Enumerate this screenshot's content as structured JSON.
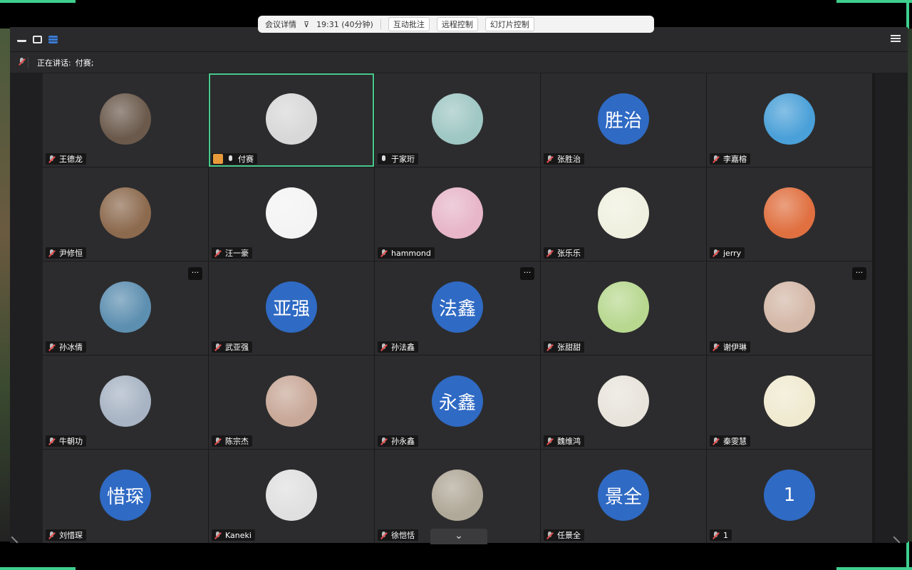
{
  "meeting_toolbar": {
    "details": "会议详情",
    "time": "19:31 (40分钟)",
    "annotation": "互动批注",
    "remote_control": "远程控制",
    "slides": "幻灯片控制"
  },
  "speaking": {
    "label": "正在讲话:",
    "name": "付赛;"
  },
  "colors": {
    "avatar_text_bg": "#2f6ac4",
    "active_border": "#49c98c",
    "tile_bg": "#2c2c2e"
  },
  "participants": [
    {
      "name": "王德龙",
      "avatar": "photo-person",
      "avatar_color": "#6b5a4c",
      "mic": "off"
    },
    {
      "name": "付赛",
      "avatar": "photo-cat",
      "avatar_color": "#d8d8d8",
      "mic": "on",
      "host": true,
      "active": true
    },
    {
      "name": "于家珩",
      "avatar": "photo-anime",
      "avatar_color": "#9fc7c4",
      "mic": "on"
    },
    {
      "name": "张胜治",
      "avatar_text": "胜治",
      "mic": "off"
    },
    {
      "name": "李嘉榕",
      "avatar": "photo-stairs",
      "avatar_color": "#4aa0d8",
      "mic": "off"
    },
    {
      "name": "尹修恒",
      "avatar": "photo-bear",
      "avatar_color": "#8c6a4e",
      "mic": "off"
    },
    {
      "name": "汪一豪",
      "avatar": "photo-sketch",
      "avatar_color": "#f4f4f4",
      "mic": "off"
    },
    {
      "name": "hammond",
      "avatar": "photo-anime-pink",
      "avatar_color": "#e7b6c8",
      "mic": "off"
    },
    {
      "name": "张乐乐",
      "avatar": "photo-cartoon",
      "avatar_color": "#f0f0e0",
      "mic": "off"
    },
    {
      "name": "jerry",
      "avatar": "photo-sunset",
      "avatar_color": "#e07040",
      "mic": "off"
    },
    {
      "name": "孙冰倩",
      "avatar": "photo-leaf",
      "avatar_color": "#5d8fb0",
      "mic": "off",
      "more": true
    },
    {
      "name": "武亚强",
      "avatar_text": "亚强",
      "mic": "off"
    },
    {
      "name": "孙法鑫",
      "avatar_text": "法鑫",
      "mic": "off",
      "more": true
    },
    {
      "name": "张甜甜",
      "avatar": "photo-cartoon-boy",
      "avatar_color": "#b8d890",
      "mic": "off"
    },
    {
      "name": "谢伊琳",
      "avatar": "photo-girl",
      "avatar_color": "#d4b8a8",
      "mic": "off",
      "more": true
    },
    {
      "name": "牛朝功",
      "avatar": "photo-cap",
      "avatar_color": "#a8b4c4",
      "mic": "off"
    },
    {
      "name": "陈宗杰",
      "avatar": "photo-face",
      "avatar_color": "#c8a898",
      "mic": "off"
    },
    {
      "name": "孙永鑫",
      "avatar_text": "永鑫",
      "mic": "off"
    },
    {
      "name": "魏维鸿",
      "avatar": "photo-poster",
      "avatar_color": "#e8e4dc",
      "mic": "off"
    },
    {
      "name": "秦雯慧",
      "avatar": "photo-crayon",
      "avatar_color": "#f0ead0",
      "mic": "off"
    },
    {
      "name": "刘惜琛",
      "avatar_text": "惜琛",
      "mic": "off"
    },
    {
      "name": "Kaneki",
      "avatar": "photo-manga",
      "avatar_color": "#e0e0e0",
      "mic": "off"
    },
    {
      "name": "徐恺恬",
      "avatar": "photo-cat-grey",
      "avatar_color": "#b0a898",
      "mic": "off"
    },
    {
      "name": "任景全",
      "avatar_text": "景全",
      "mic": "off"
    },
    {
      "name": "1",
      "avatar_text": "1",
      "mic": "off"
    }
  ],
  "icons": {
    "minimize": "minimize-icon",
    "window": "window-icon",
    "layout": "list-layout-icon",
    "menu": "menu-icon",
    "expand": "chevron-down-icon",
    "more": "more-icon"
  },
  "labels": {
    "more": "···",
    "expand": "⌄"
  }
}
